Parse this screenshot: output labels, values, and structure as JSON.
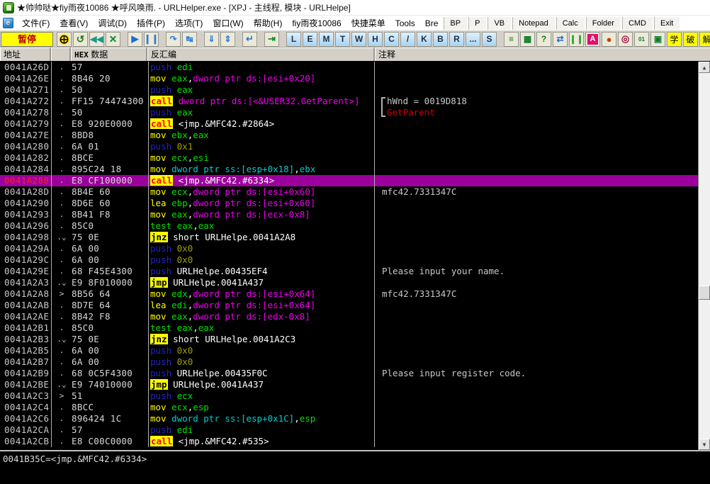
{
  "window": {
    "title": "★帅帅哒★fiy雨夜10086  ★呼风唤雨. - URLHelper.exe - [XPJ -  主线程, 模块 - URLHelpe]",
    "icon": "olly-app-icon"
  },
  "menubar": {
    "items": [
      "文件(F)",
      "查看(V)",
      "调试(D)",
      "插件(P)",
      "选项(T)",
      "窗口(W)",
      "帮助(H)",
      "fiy雨夜10086",
      "快捷菜单",
      "Tools",
      "Bre"
    ],
    "buttons": [
      "BP",
      "P",
      "VB",
      "Notepad",
      "Calc",
      "Folder",
      "CMD",
      "Exit"
    ]
  },
  "toolbar": {
    "status_label": "暂停",
    "buttons": [
      {
        "name": "open-module-icon",
        "glyph": "⊕"
      },
      {
        "name": "restart-icon",
        "glyph": "↺"
      },
      {
        "name": "close-rewind-icon",
        "glyph": "«"
      },
      {
        "name": "terminate-icon",
        "glyph": "✕"
      },
      {
        "name": "run-icon",
        "glyph": "▶"
      },
      {
        "name": "pause-icon",
        "glyph": "‖"
      },
      {
        "name": "step-into-icon",
        "glyph": "⤓"
      },
      {
        "name": "step-over-icon",
        "glyph": "→"
      },
      {
        "name": "trace-into-icon",
        "glyph": "⇲"
      },
      {
        "name": "trace-over-icon",
        "glyph": "⇳"
      },
      {
        "name": "execute-till-return-icon",
        "glyph": "↵"
      },
      {
        "name": "run-to-cursor-icon",
        "glyph": "⇥"
      }
    ],
    "letter_buttons": [
      "L",
      "E",
      "M",
      "T",
      "W",
      "H",
      "C",
      "/",
      "K",
      "B",
      "R",
      "...",
      "S"
    ],
    "extra_buttons": [
      {
        "name": "options-list-icon",
        "glyph": "≡"
      },
      {
        "name": "windows-grid-icon",
        "glyph": "▦"
      },
      {
        "name": "help-icon",
        "glyph": "?"
      }
    ],
    "right_buttons": [
      {
        "name": "sync-icon",
        "glyph": "⇄"
      },
      {
        "name": "pause-green-icon",
        "glyph": "‖"
      },
      {
        "name": "analyze-icon",
        "glyph": "A"
      },
      {
        "name": "record-icon",
        "glyph": "●"
      },
      {
        "name": "target-icon",
        "glyph": "◎"
      },
      {
        "name": "binary-icon",
        "glyph": "01"
      },
      {
        "name": "monitor-icon",
        "glyph": "▣"
      },
      {
        "name": "learn-icon",
        "glyph": "学"
      },
      {
        "name": "crack-icon",
        "glyph": "破"
      },
      {
        "name": "decode-icon",
        "glyph": "解"
      }
    ]
  },
  "columns": {
    "address": "地址",
    "hex_prefix": "HEX",
    "hex": "数据",
    "disasm": "反汇编",
    "comment": "注释"
  },
  "disassembly": {
    "selected_index": 11,
    "rows": [
      {
        "addr": "0041A26D",
        "mark": ".",
        "hex": "57",
        "asm": [
          {
            "t": "push",
            "c": "op-push"
          },
          {
            "t": " "
          },
          {
            "t": "edi",
            "c": "reg"
          }
        ],
        "cmt": ""
      },
      {
        "addr": "0041A26E",
        "mark": ".",
        "hex": "8B46 20",
        "asm": [
          {
            "t": "mov",
            "c": "op-mov"
          },
          {
            "t": " "
          },
          {
            "t": "eax",
            "c": "reg"
          },
          {
            "t": ",",
            "c": "plain"
          },
          {
            "t": "dword ptr ds:[esi+0x20]",
            "c": "mem"
          }
        ],
        "cmt": ""
      },
      {
        "addr": "0041A271",
        "mark": ".",
        "hex": "50",
        "asm": [
          {
            "t": "push",
            "c": "op-push"
          },
          {
            "t": " "
          },
          {
            "t": "eax",
            "c": "reg"
          }
        ],
        "cmt": ""
      },
      {
        "addr": "0041A272",
        "mark": ".",
        "hex": "FF15 74474300",
        "asm": [
          {
            "t": "call",
            "c": "op-call"
          },
          {
            "t": " "
          },
          {
            "t": "dword ptr ds:[<&USER32.GetParent>]",
            "c": "mem"
          }
        ],
        "cmt": ""
      },
      {
        "addr": "0041A278",
        "mark": ".",
        "hex": "50",
        "asm": [
          {
            "t": "push",
            "c": "op-push"
          },
          {
            "t": " "
          },
          {
            "t": "eax",
            "c": "reg"
          }
        ],
        "cmt": ""
      },
      {
        "addr": "0041A279",
        "mark": ".",
        "hex": "E8 920E0000",
        "asm": [
          {
            "t": "call",
            "c": "op-call"
          },
          {
            "t": " "
          },
          {
            "t": "<jmp.&MFC42.#2864>",
            "c": "sym"
          }
        ],
        "cmt": ""
      },
      {
        "addr": "0041A27E",
        "mark": ".",
        "hex": "8BD8",
        "asm": [
          {
            "t": "mov",
            "c": "op-mov"
          },
          {
            "t": " "
          },
          {
            "t": "ebx",
            "c": "reg"
          },
          {
            "t": ",",
            "c": "plain"
          },
          {
            "t": "eax",
            "c": "reg"
          }
        ],
        "cmt": ""
      },
      {
        "addr": "0041A280",
        "mark": ".",
        "hex": "6A 01",
        "asm": [
          {
            "t": "push",
            "c": "op-push"
          },
          {
            "t": " "
          },
          {
            "t": "0x1",
            "c": "num"
          }
        ],
        "cmt": ""
      },
      {
        "addr": "0041A282",
        "mark": ".",
        "hex": "8BCE",
        "asm": [
          {
            "t": "mov",
            "c": "op-mov"
          },
          {
            "t": " "
          },
          {
            "t": "ecx",
            "c": "reg"
          },
          {
            "t": ",",
            "c": "plain"
          },
          {
            "t": "esi",
            "c": "reg"
          }
        ],
        "cmt": ""
      },
      {
        "addr": "0041A284",
        "mark": ".",
        "hex": "895C24 18",
        "asm": [
          {
            "t": "mov",
            "c": "op-mov"
          },
          {
            "t": " "
          },
          {
            "t": "dword ptr ss:[esp+0x18]",
            "c": "reg2"
          },
          {
            "t": ",",
            "c": "plain"
          },
          {
            "t": "ebx",
            "c": "reg2"
          }
        ],
        "cmt": ""
      },
      {
        "addr": "0041A288",
        "mark": ".",
        "hex": "E8 CF100000",
        "asm": [
          {
            "t": "call",
            "c": "op-call"
          },
          {
            "t": " "
          },
          {
            "t": "<jmp.&MFC42.#6334>",
            "c": "sym"
          }
        ],
        "cmt": "",
        "selected": true
      },
      {
        "addr": "0041A28D",
        "mark": ".",
        "hex": "8B4E 60",
        "asm": [
          {
            "t": "mov",
            "c": "op-mov"
          },
          {
            "t": " "
          },
          {
            "t": "ecx",
            "c": "reg"
          },
          {
            "t": ",",
            "c": "plain"
          },
          {
            "t": "dword ptr ds:[esi+0x60]",
            "c": "mem"
          }
        ],
        "cmt": "mfc42.7331347C"
      },
      {
        "addr": "0041A290",
        "mark": ".",
        "hex": "8D6E 60",
        "asm": [
          {
            "t": "lea",
            "c": "op-lea"
          },
          {
            "t": " "
          },
          {
            "t": "ebp",
            "c": "reg"
          },
          {
            "t": ",",
            "c": "plain"
          },
          {
            "t": "dword ptr ds:[esi+0x60]",
            "c": "mem"
          }
        ],
        "cmt": ""
      },
      {
        "addr": "0041A293",
        "mark": ".",
        "hex": "8B41 F8",
        "asm": [
          {
            "t": "mov",
            "c": "op-mov"
          },
          {
            "t": " "
          },
          {
            "t": "eax",
            "c": "reg"
          },
          {
            "t": ",",
            "c": "plain"
          },
          {
            "t": "dword ptr ds:[ecx-0x8]",
            "c": "mem"
          }
        ],
        "cmt": ""
      },
      {
        "addr": "0041A296",
        "mark": ".",
        "hex": "85C0",
        "asm": [
          {
            "t": "test",
            "c": "op-test"
          },
          {
            "t": " "
          },
          {
            "t": "eax",
            "c": "reg"
          },
          {
            "t": ",",
            "c": "plain"
          },
          {
            "t": "eax",
            "c": "reg"
          }
        ],
        "cmt": ""
      },
      {
        "addr": "0041A298",
        "mark": ".⌄",
        "hex": "75 0E",
        "asm": [
          {
            "t": "jnz",
            "c": "op-jcc"
          },
          {
            "t": " "
          },
          {
            "t": "short URLHelpe.0041A2A8",
            "c": "sym"
          }
        ],
        "cmt": ""
      },
      {
        "addr": "0041A29A",
        "mark": ".",
        "hex": "6A 00",
        "asm": [
          {
            "t": "push",
            "c": "op-push"
          },
          {
            "t": " "
          },
          {
            "t": "0x0",
            "c": "num"
          }
        ],
        "cmt": ""
      },
      {
        "addr": "0041A29C",
        "mark": ".",
        "hex": "6A 00",
        "asm": [
          {
            "t": "push",
            "c": "op-push"
          },
          {
            "t": " "
          },
          {
            "t": "0x0",
            "c": "num"
          }
        ],
        "cmt": ""
      },
      {
        "addr": "0041A29E",
        "mark": ".",
        "hex": "68 F45E4300",
        "asm": [
          {
            "t": "push",
            "c": "op-push"
          },
          {
            "t": " "
          },
          {
            "t": "URLHelpe.00435EF4",
            "c": "sym"
          }
        ],
        "cmt": "Please input your name."
      },
      {
        "addr": "0041A2A3",
        "mark": ".⌄",
        "hex": "E9 8F010000",
        "asm": [
          {
            "t": "jmp",
            "c": "op-jcc"
          },
          {
            "t": " "
          },
          {
            "t": "URLHelpe.0041A437",
            "c": "sym"
          }
        ],
        "cmt": ""
      },
      {
        "addr": "0041A2A8",
        "mark": ">",
        "hex": "8B56 64",
        "asm": [
          {
            "t": "mov",
            "c": "op-mov"
          },
          {
            "t": " "
          },
          {
            "t": "edx",
            "c": "reg"
          },
          {
            "t": ",",
            "c": "plain"
          },
          {
            "t": "dword ptr ds:[esi+0x64]",
            "c": "mem"
          }
        ],
        "cmt": "mfc42.7331347C"
      },
      {
        "addr": "0041A2AB",
        "mark": ".",
        "hex": "8D7E 64",
        "asm": [
          {
            "t": "lea",
            "c": "op-lea"
          },
          {
            "t": " "
          },
          {
            "t": "edi",
            "c": "reg"
          },
          {
            "t": ",",
            "c": "plain"
          },
          {
            "t": "dword ptr ds:[esi+0x64]",
            "c": "mem"
          }
        ],
        "cmt": ""
      },
      {
        "addr": "0041A2AE",
        "mark": ".",
        "hex": "8B42 F8",
        "asm": [
          {
            "t": "mov",
            "c": "op-mov"
          },
          {
            "t": " "
          },
          {
            "t": "eax",
            "c": "reg"
          },
          {
            "t": ",",
            "c": "plain"
          },
          {
            "t": "dword ptr ds:[edx-0x8]",
            "c": "mem"
          }
        ],
        "cmt": ""
      },
      {
        "addr": "0041A2B1",
        "mark": ".",
        "hex": "85C0",
        "asm": [
          {
            "t": "test",
            "c": "op-test"
          },
          {
            "t": " "
          },
          {
            "t": "eax",
            "c": "reg"
          },
          {
            "t": ",",
            "c": "plain"
          },
          {
            "t": "eax",
            "c": "reg"
          }
        ],
        "cmt": ""
      },
      {
        "addr": "0041A2B3",
        "mark": ".⌄",
        "hex": "75 0E",
        "asm": [
          {
            "t": "jnz",
            "c": "op-jcc"
          },
          {
            "t": " "
          },
          {
            "t": "short URLHelpe.0041A2C3",
            "c": "sym"
          }
        ],
        "cmt": ""
      },
      {
        "addr": "0041A2B5",
        "mark": ".",
        "hex": "6A 00",
        "asm": [
          {
            "t": "push",
            "c": "op-push"
          },
          {
            "t": " "
          },
          {
            "t": "0x0",
            "c": "num"
          }
        ],
        "cmt": ""
      },
      {
        "addr": "0041A2B7",
        "mark": ".",
        "hex": "6A 00",
        "asm": [
          {
            "t": "push",
            "c": "op-push"
          },
          {
            "t": " "
          },
          {
            "t": "0x0",
            "c": "num"
          }
        ],
        "cmt": ""
      },
      {
        "addr": "0041A2B9",
        "mark": ".",
        "hex": "68 0C5F4300",
        "asm": [
          {
            "t": "push",
            "c": "op-push"
          },
          {
            "t": " "
          },
          {
            "t": "URLHelpe.00435F0C",
            "c": "sym"
          }
        ],
        "cmt": "Please input register code."
      },
      {
        "addr": "0041A2BE",
        "mark": ".⌄",
        "hex": "E9 74010000",
        "asm": [
          {
            "t": "jmp",
            "c": "op-jcc"
          },
          {
            "t": " "
          },
          {
            "t": "URLHelpe.0041A437",
            "c": "sym"
          }
        ],
        "cmt": ""
      },
      {
        "addr": "0041A2C3",
        "mark": ">",
        "hex": "51",
        "asm": [
          {
            "t": "push",
            "c": "op-push"
          },
          {
            "t": " "
          },
          {
            "t": "ecx",
            "c": "reg"
          }
        ],
        "cmt": ""
      },
      {
        "addr": "0041A2C4",
        "mark": ".",
        "hex": "8BCC",
        "asm": [
          {
            "t": "mov",
            "c": "op-mov"
          },
          {
            "t": " "
          },
          {
            "t": "ecx",
            "c": "reg"
          },
          {
            "t": ",",
            "c": "plain"
          },
          {
            "t": "esp",
            "c": "reg"
          }
        ],
        "cmt": ""
      },
      {
        "addr": "0041A2C6",
        "mark": ".",
        "hex": "896424 1C",
        "asm": [
          {
            "t": "mov",
            "c": "op-mov"
          },
          {
            "t": " "
          },
          {
            "t": "dword ptr ss:[esp+0x1C]",
            "c": "reg2"
          },
          {
            "t": ",",
            "c": "plain"
          },
          {
            "t": "esp",
            "c": "reg"
          }
        ],
        "cmt": ""
      },
      {
        "addr": "0041A2CA",
        "mark": ".",
        "hex": "57",
        "asm": [
          {
            "t": "push",
            "c": "op-push"
          },
          {
            "t": " "
          },
          {
            "t": "edi",
            "c": "reg"
          }
        ],
        "cmt": ""
      },
      {
        "addr": "0041A2CB",
        "mark": ".",
        "hex": "E8 C00C0000",
        "asm": [
          {
            "t": "call",
            "c": "op-call"
          },
          {
            "t": " "
          },
          {
            "t": "<jmp.&MFC42.#535>",
            "c": "sym"
          }
        ],
        "cmt": ""
      }
    ],
    "bracket_comment": {
      "line1": "hWnd = 0019D818",
      "line2": "GetParent"
    }
  },
  "statusbar": {
    "text": "0041B35C=<jmp.&MFC42.#6334>"
  },
  "colors": {
    "selection": "#9c009c",
    "call_highlight": "#ffff00",
    "pause_bg": "#ffff00",
    "pause_fg": "#c00000",
    "window_bg": "#d4d0c8",
    "pane_bg": "#000000"
  }
}
